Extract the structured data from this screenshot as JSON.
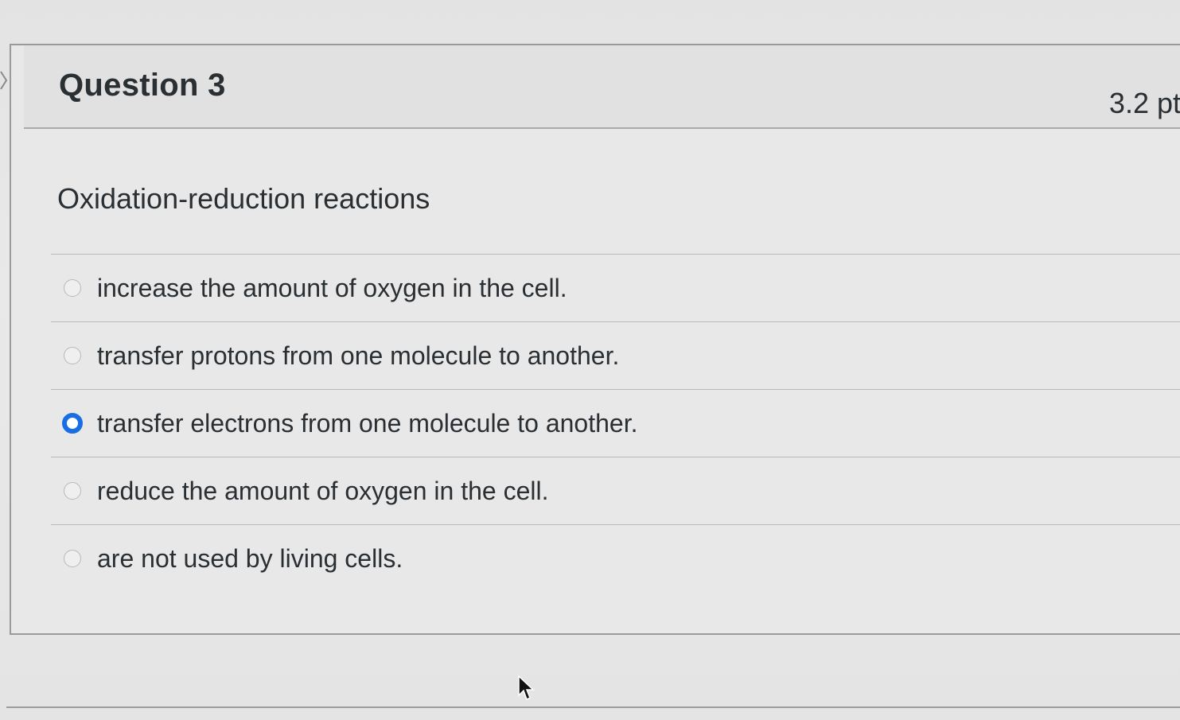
{
  "question": {
    "title": "Question 3",
    "points": "3.2 pt",
    "text": "Oxidation-reduction reactions"
  },
  "answers": [
    {
      "label": "increase the amount of oxygen in the cell.",
      "selected": false
    },
    {
      "label": "transfer protons from one molecule to another.",
      "selected": false
    },
    {
      "label": "transfer electrons from one molecule to another.",
      "selected": true
    },
    {
      "label": "reduce the amount of oxygen in the cell.",
      "selected": false
    },
    {
      "label": "are not used by living cells.",
      "selected": false
    }
  ],
  "colors": {
    "selected_radio": "#1a6ee3",
    "text": "#2a2f33"
  },
  "icons": {
    "cursor": "mouse-pointer-icon",
    "nav": "chevron-right-icon"
  }
}
